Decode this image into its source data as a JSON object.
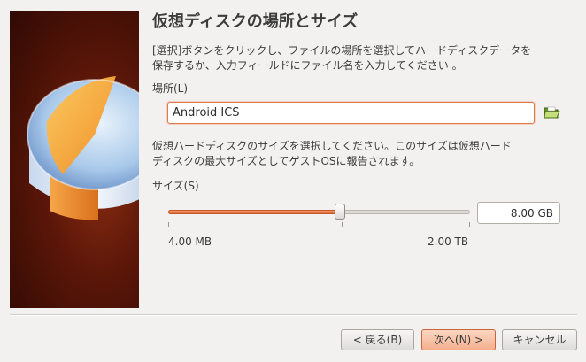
{
  "wizard": {
    "title": "仮想ディスクの場所とサイズ",
    "description_location_line1": "[選択]ボタンをクリックし、ファイルの場所を選択してハードディスクデータを",
    "description_location_line2": "保存するか、入力フィールドにファイル名を入力してください 。",
    "location_label": "場所(L)",
    "location_value": "Android ICS",
    "description_size_line1": "仮想ハードディスクのサイズを選択してください。このサイズは仮想ハード",
    "description_size_line2": "ディスクの最大サイズとしてゲストOSに報告されます。",
    "size_label": "サイズ(S)",
    "size_value": "8.00 GB",
    "slider_min_label": "4.00 MB",
    "slider_max_label": "2.00 TB",
    "slider_position": 0.57
  },
  "buttons": {
    "back": "< 戻る(B)",
    "next": "次へ(N) >",
    "cancel": "キャンセル"
  },
  "colors": {
    "accent": "#e06a34",
    "sidebar_bg": "#5a1608"
  },
  "icons": {
    "folder": "folder-open-icon",
    "wizard_image": "hard-disk-image"
  }
}
